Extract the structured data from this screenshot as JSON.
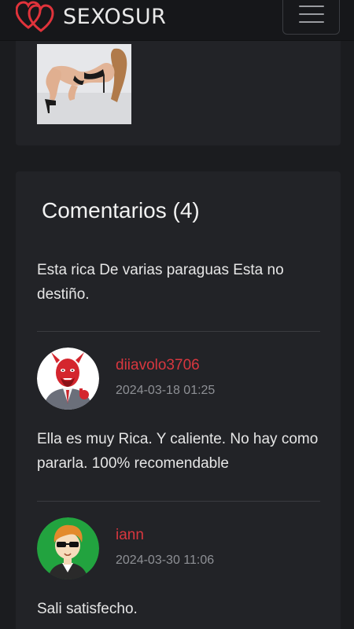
{
  "header": {
    "brand": "SEXOSUR",
    "logo_icon": "double-heart-logo",
    "menu_icon": "hamburger-menu-icon"
  },
  "listing": {
    "photo_alt": "photo-thumbnail"
  },
  "comments": {
    "title": "Comentarios (4)",
    "intro_text": "Esta rica De varias paraguas Esta no destiño.",
    "items": [
      {
        "username": "diiavolo3706",
        "date": "2024-03-18 01:25",
        "text": "Ella es muy Rica. Y caliente. No hay como pararla. 100% recomendable",
        "avatar": "devil-avatar"
      },
      {
        "username": "iann",
        "date": "2024-03-30 11:06",
        "text": "Sali satisfecho.",
        "avatar": "sunglasses-avatar"
      }
    ]
  },
  "colors": {
    "accent": "#d8373f",
    "background": "#1b1c1f",
    "card": "#222327"
  }
}
